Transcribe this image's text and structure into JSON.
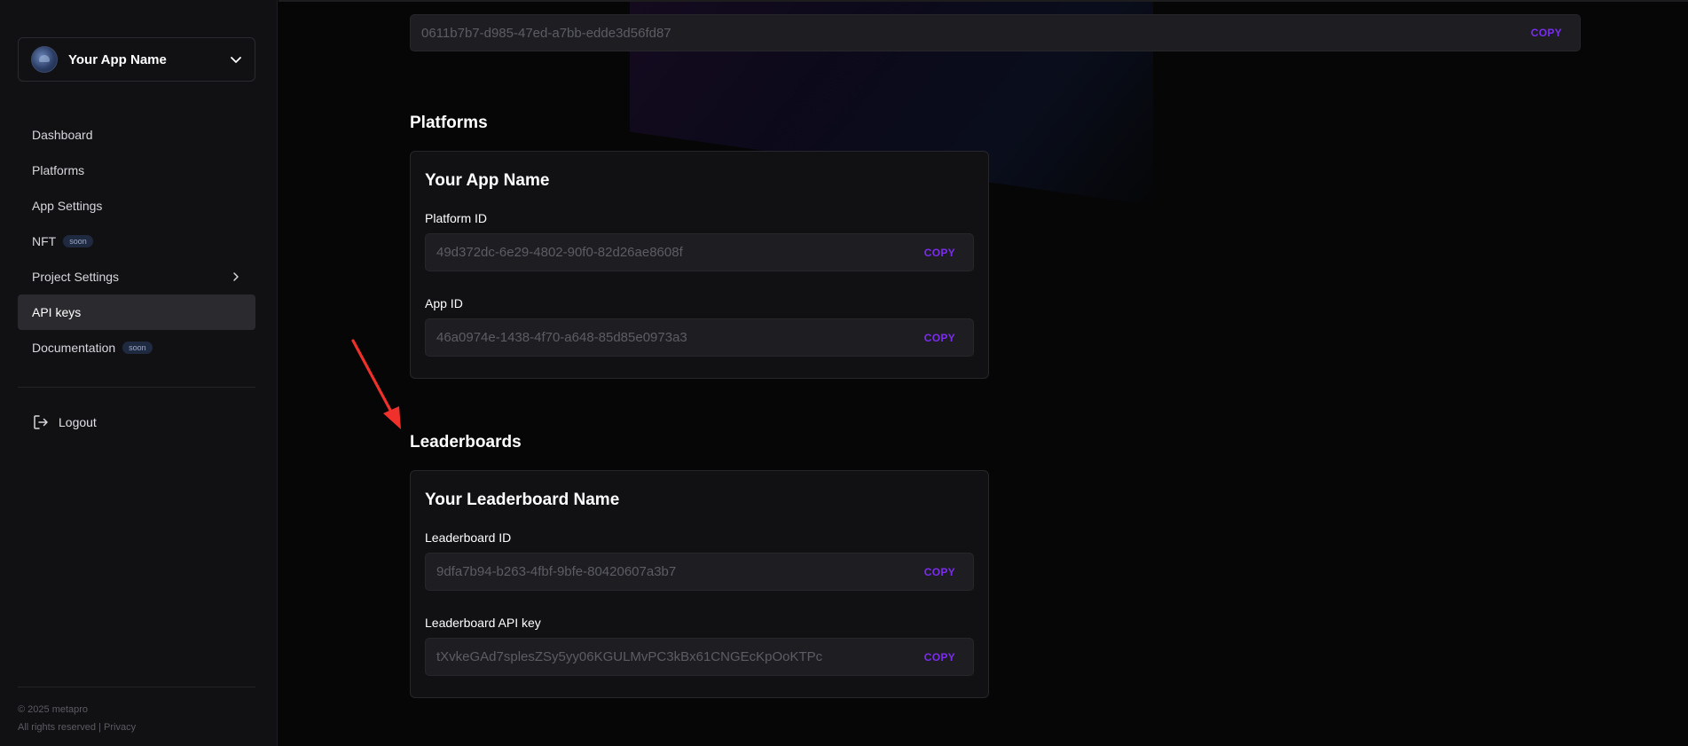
{
  "sidebar": {
    "app_name": "Your App Name",
    "nav": [
      {
        "label": "Dashboard",
        "badge": "",
        "chevron": false,
        "active": false
      },
      {
        "label": "Platforms",
        "badge": "",
        "chevron": false,
        "active": false
      },
      {
        "label": "App Settings",
        "badge": "",
        "chevron": false,
        "active": false
      },
      {
        "label": "NFT",
        "badge": "soon",
        "chevron": false,
        "active": false
      },
      {
        "label": "Project Settings",
        "badge": "",
        "chevron": true,
        "active": false
      },
      {
        "label": "API keys",
        "badge": "",
        "chevron": false,
        "active": true
      },
      {
        "label": "Documentation",
        "badge": "soon",
        "chevron": false,
        "active": false
      }
    ],
    "logout_label": "Logout",
    "footer": {
      "copyright": "© 2025 metapro",
      "rights": "All rights reserved | ",
      "privacy": "Privacy"
    }
  },
  "main": {
    "top_field": {
      "value": "0611b7b7-d985-47ed-a7bb-edde3d56fd87",
      "copy_label": "COPY"
    },
    "platforms": {
      "section_title": "Platforms",
      "card_title": "Your App Name",
      "fields": [
        {
          "label": "Platform ID",
          "value": "49d372dc-6e29-4802-90f0-82d26ae8608f",
          "copy_label": "COPY"
        },
        {
          "label": "App ID",
          "value": "46a0974e-1438-4f70-a648-85d85e0973a3",
          "copy_label": "COPY"
        }
      ]
    },
    "leaderboards": {
      "section_title": "Leaderboards",
      "card_title": "Your Leaderboard Name",
      "fields": [
        {
          "label": "Leaderboard ID",
          "value": "9dfa7b94-b263-4fbf-9bfe-80420607a3b7",
          "copy_label": "COPY"
        },
        {
          "label": "Leaderboard API key",
          "value": "tXvkeGAd7splesZSy5yy06KGULMvPC3kBx61CNGEcKpOoKTPc",
          "copy_label": "COPY"
        }
      ]
    }
  },
  "colors": {
    "accent": "#7a2cf0",
    "annotation_arrow": "#f0302a",
    "sidebar_bg": "#111114",
    "page_bg": "#060607"
  },
  "icons": {
    "switcher": "chevron-down-icon",
    "project_settings": "chevron-right-icon",
    "logout": "logout-icon",
    "annotation": "red-arrow-icon"
  }
}
